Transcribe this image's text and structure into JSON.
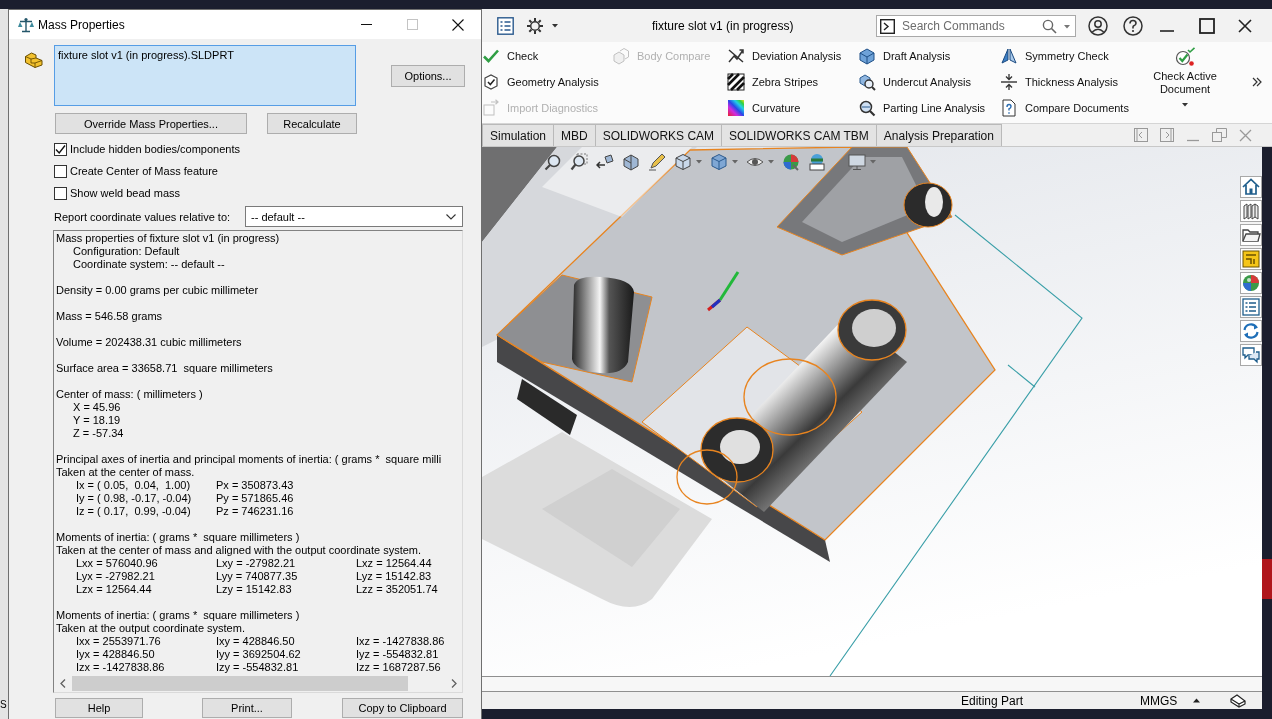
{
  "background_window": {
    "text": "S"
  },
  "dialog": {
    "title": "Mass Properties",
    "selection_list": [
      "fixture slot v1 (in progress).SLDPRT"
    ],
    "options_button": "Options...",
    "override_button": "Override Mass Properties...",
    "recalculate_button": "Recalculate",
    "checkboxes": [
      {
        "label": "Include hidden bodies/components",
        "checked": true
      },
      {
        "label": "Create Center of Mass feature",
        "checked": false
      },
      {
        "label": "Show weld bead mass",
        "checked": false
      }
    ],
    "coordinate_select": {
      "label": "Report coordinate values relative to:",
      "value": "-- default --"
    },
    "results": [
      {
        "lines": [
          {
            "kind": "plain",
            "text": "Mass properties of fixture slot v1 (in progress)"
          },
          {
            "kind": "indented",
            "text": "Configuration: Default"
          },
          {
            "kind": "indented",
            "text": "Coordinate system: -- default --"
          }
        ]
      },
      {
        "lines": [
          {
            "kind": "plain",
            "text": "Density = 0.00 grams per cubic millimeter"
          }
        ]
      },
      {
        "lines": [
          {
            "kind": "plain",
            "text": "Mass = 546.58 grams"
          }
        ]
      },
      {
        "lines": [
          {
            "kind": "plain",
            "text": "Volume = 202438.31 cubic millimeters"
          }
        ]
      },
      {
        "lines": [
          {
            "kind": "plain",
            "text": "Surface area = 33658.71  square millimeters"
          }
        ]
      },
      {
        "lines": [
          {
            "kind": "plain",
            "text": "Center of mass: ( millimeters )"
          },
          {
            "kind": "indented",
            "text": "X = 45.96"
          },
          {
            "kind": "indented",
            "text": "Y = 18.19"
          },
          {
            "kind": "indented",
            "text": "Z = -57.34"
          }
        ]
      },
      {
        "lines": [
          {
            "kind": "plain",
            "text": "Principal axes of inertia and principal moments of inertia: ( grams *  square milli"
          },
          {
            "kind": "plain",
            "text": "Taken at the center of mass."
          },
          {
            "kind": "values",
            "cells": [
              "Ix = ( 0.05,  0.04,  1.00)",
              "Px = 350873.43"
            ]
          },
          {
            "kind": "values",
            "cells": [
              "Iy = ( 0.98, -0.17, -0.04)",
              "Py = 571865.46"
            ]
          },
          {
            "kind": "values",
            "cells": [
              "Iz = ( 0.17,  0.99, -0.04)",
              "Pz = 746231.16"
            ]
          }
        ]
      },
      {
        "lines": [
          {
            "kind": "plain",
            "text": "Moments of inertia: ( grams *  square millimeters )"
          },
          {
            "kind": "plain",
            "text": "Taken at the center of mass and aligned with the output coordinate system."
          },
          {
            "kind": "values",
            "cells": [
              "Lxx = 576040.96",
              "Lxy = -27982.21",
              "Lxz = 12564.44"
            ]
          },
          {
            "kind": "values",
            "cells": [
              "Lyx = -27982.21",
              "Lyy = 740877.35",
              "Lyz = 15142.83"
            ]
          },
          {
            "kind": "values",
            "cells": [
              "Lzx = 12564.44",
              "Lzy = 15142.83",
              "Lzz = 352051.74"
            ]
          }
        ]
      },
      {
        "lines": [
          {
            "kind": "plain",
            "text": "Moments of inertia: ( grams *  square millimeters )"
          },
          {
            "kind": "plain",
            "text": "Taken at the output coordinate system."
          },
          {
            "kind": "values",
            "cells": [
              "Ixx = 2553971.76",
              "Ixy = 428846.50",
              "Ixz = -1427838.86"
            ]
          },
          {
            "kind": "values",
            "cells": [
              "Iyx = 428846.50",
              "Iyy = 3692504.62",
              "Iyz = -554832.81"
            ]
          },
          {
            "kind": "values",
            "cells": [
              "Izx = -1427838.86",
              "Izy = -554832.81",
              "Izz = 1687287.56"
            ]
          }
        ]
      }
    ],
    "buttons": [
      "Help",
      "Print...",
      "Copy to Clipboard"
    ]
  },
  "cad_window": {
    "title": "fixture slot v1 (in progress)",
    "search": {
      "placeholder": "Search Commands"
    },
    "ribbon": {
      "columns": [
        {
          "items": [
            {
              "label": "Check",
              "disabled": false
            },
            {
              "label": "Geometry Analysis",
              "disabled": false
            },
            {
              "label": "Import Diagnostics",
              "disabled": true
            }
          ]
        },
        {
          "items": [
            {
              "label": "Body Compare",
              "disabled": true
            }
          ]
        },
        {
          "items": [
            {
              "label": "Deviation Analysis",
              "disabled": false
            },
            {
              "label": "Zebra Stripes",
              "disabled": false
            },
            {
              "label": "Curvature",
              "disabled": false
            }
          ]
        },
        {
          "items": [
            {
              "label": "Draft Analysis",
              "disabled": false
            },
            {
              "label": "Undercut Analysis",
              "disabled": false
            },
            {
              "label": "Parting Line Analysis",
              "disabled": false
            }
          ]
        },
        {
          "items": [
            {
              "label": "Symmetry Check",
              "disabled": false
            },
            {
              "label": "Thickness Analysis",
              "disabled": false
            },
            {
              "label": "Compare Documents",
              "disabled": false
            }
          ]
        }
      ],
      "large_button": "Check Active Document"
    },
    "tabs": [
      {
        "label": "Simulation",
        "selected": false
      },
      {
        "label": "MBD",
        "selected": false
      },
      {
        "label": "SOLIDWORKS CAM",
        "selected": false
      },
      {
        "label": "SOLIDWORKS CAM TBM",
        "selected": false
      },
      {
        "label": "Analysis Preparation",
        "selected": false
      }
    ],
    "status_bar": {
      "mode": "Editing Part",
      "units": "MMGS"
    }
  }
}
